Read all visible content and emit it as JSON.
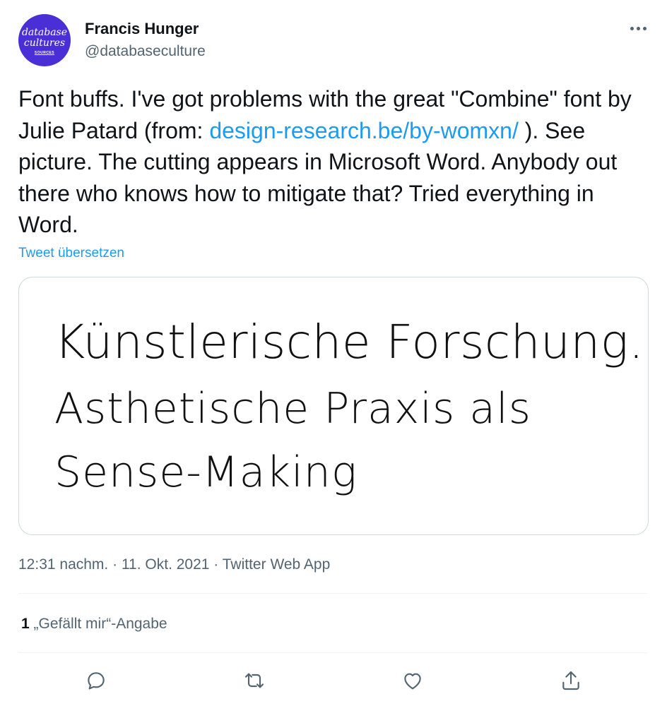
{
  "author": {
    "name": "Francis Hunger",
    "handle": "@databaseculture",
    "avatar_lines": [
      "database",
      "cultures",
      "SOURCES"
    ],
    "avatar_color": "#4a2fd6"
  },
  "tweet": {
    "text_before_link": "Font buffs. I've got problems with the great \"Combine\" font by Julie Patard (from: ",
    "link": "design-research.be/by-womxn/",
    "text_after_link": " ). See picture. The cutting appears in Microsoft Word. Anybody out there who knows how to mitigate that? Tried everything in Word.",
    "translate_label": "Tweet übersetzen"
  },
  "media": {
    "lines": [
      "Künstlerische Forschung.",
      "Asthetische Praxis als",
      "Sense-Making"
    ]
  },
  "meta": {
    "time": "12:31 nachm.",
    "date": "11. Okt. 2021",
    "source": "Twitter Web App",
    "separator": " · "
  },
  "likes": {
    "count": "1",
    "label": "„Gefällt mir“-Angabe"
  },
  "actions": {
    "icons": [
      "reply-icon",
      "retweet-icon",
      "like-icon",
      "share-icon"
    ]
  },
  "colors": {
    "link": "#1d9bf0",
    "text": "#0f1419",
    "secondary": "#536471",
    "border": "#cfd9de"
  }
}
